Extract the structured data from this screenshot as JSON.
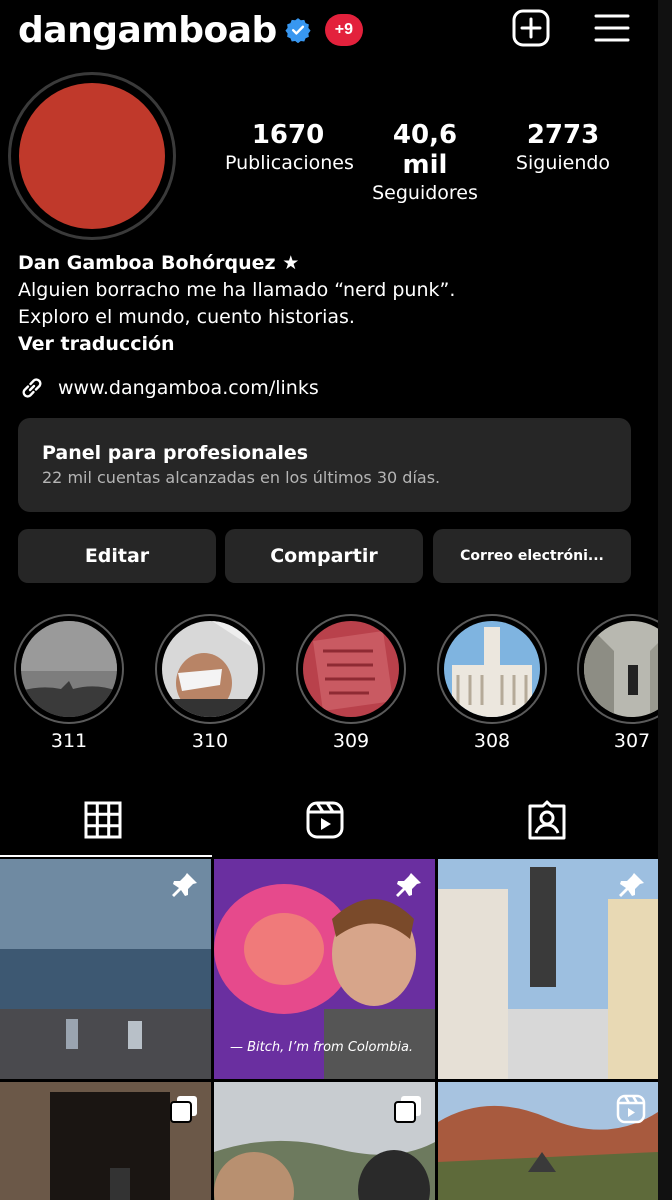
{
  "header": {
    "username": "dangamboab",
    "notification_badge": "+9",
    "icons": [
      "verified-icon",
      "add-post-icon",
      "hamburger-menu-icon"
    ]
  },
  "stats": {
    "posts": {
      "value": "1670",
      "label": "Publicaciones"
    },
    "followers": {
      "value": "40,6 mil",
      "label": "Seguidores"
    },
    "following": {
      "value": "2773",
      "label": "Siguiendo"
    }
  },
  "bio": {
    "name": "Dan Gamboa Bohórquez ★",
    "line1": "Alguien borracho me ha llamado “nerd punk”.",
    "line2": "Exploro el mundo, cuento historias.",
    "translate": "Ver traducción",
    "link": "www.dangamboa.com/links"
  },
  "panel": {
    "title": "Panel para profesionales",
    "subtitle": "22 mil cuentas alcanzadas en los últimos 30 días."
  },
  "buttons": {
    "edit": "Editar",
    "share": "Compartir",
    "email": "Correo electróni..."
  },
  "highlights": [
    {
      "label": "311"
    },
    {
      "label": "310"
    },
    {
      "label": "309"
    },
    {
      "label": "308"
    },
    {
      "label": "307"
    }
  ],
  "tabs": [
    "grid-icon",
    "reels-icon",
    "tagged-icon"
  ],
  "posts": [
    {
      "type": "pinned"
    },
    {
      "type": "pinned",
      "caption": "— Bitch, I’m from Colombia."
    },
    {
      "type": "pinned"
    },
    {
      "type": "carousel"
    },
    {
      "type": "carousel"
    },
    {
      "type": "reel"
    }
  ],
  "colors": {
    "background": "#000000",
    "surface": "#262626",
    "notification": "#e3213c",
    "verified": "#3897f0"
  }
}
